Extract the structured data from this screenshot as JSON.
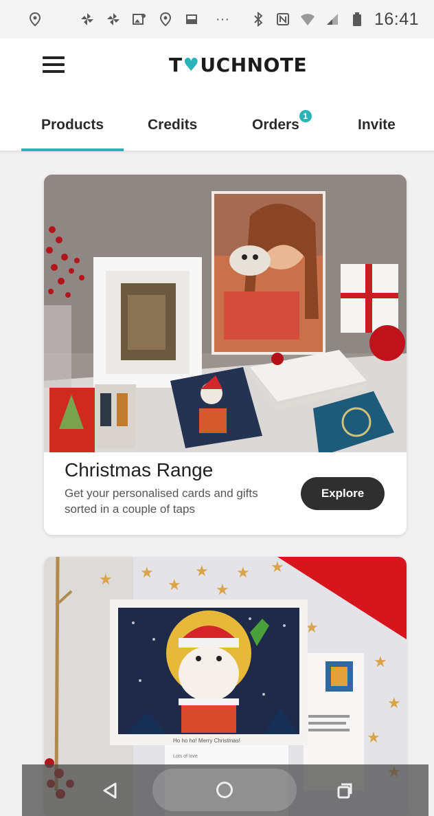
{
  "status_bar": {
    "time": "16:41",
    "icons": [
      "location-icon",
      "moon-icon",
      "pinwheel-icon",
      "pinwheel-icon",
      "gallery-icon",
      "location-icon",
      "image-icon",
      "more-dots-icon",
      "bluetooth-icon",
      "nfc-icon",
      "wifi-icon",
      "signal-icon",
      "battery-icon"
    ],
    "more": "···"
  },
  "app_bar": {
    "logo_left": "T",
    "logo_right": "UCHNOTE",
    "brand_color": "#2bb3b9"
  },
  "tabs": {
    "items": [
      {
        "label": "Products",
        "active": true
      },
      {
        "label": "Credits"
      },
      {
        "label": "Orders",
        "badge": "1"
      },
      {
        "label": "Invite"
      }
    ]
  },
  "cards": [
    {
      "title": "Christmas Range",
      "description": "Get your personalised cards and gifts sorted in a couple of taps",
      "button_label": "Explore"
    },
    {
      "title": "",
      "card_text": "Ho ho ho! Merry Christmas!",
      "sign_off": "Lots of love"
    }
  ],
  "nav_bar": {
    "buttons": [
      "back",
      "home",
      "recents"
    ]
  }
}
